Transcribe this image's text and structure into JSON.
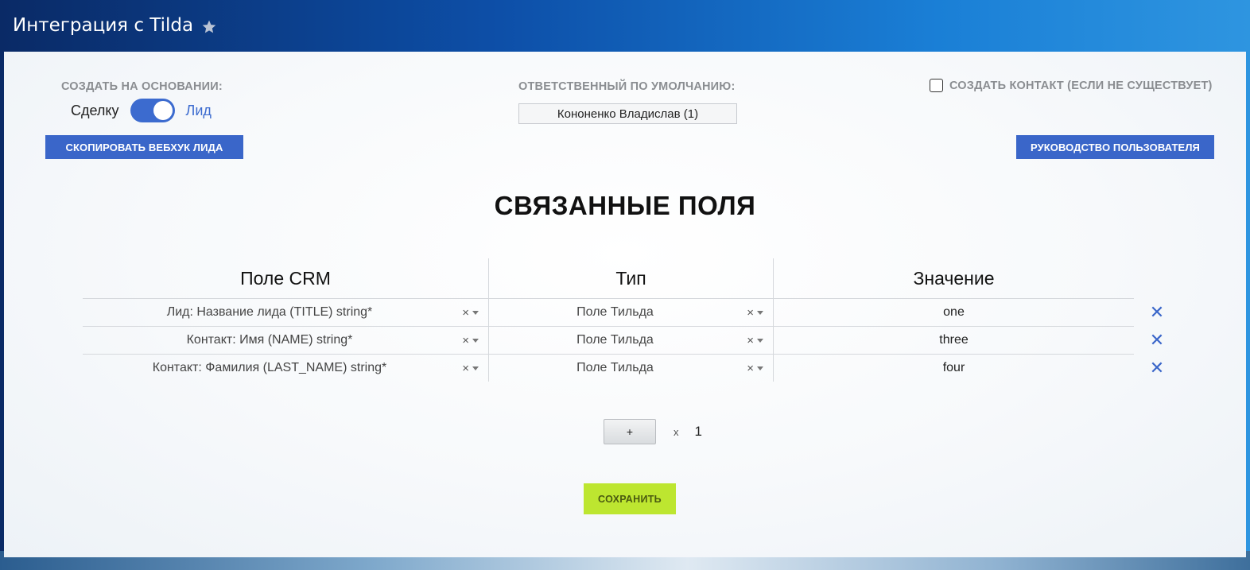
{
  "header": {
    "title": "Интеграция с Tilda",
    "star_icon": "star-icon"
  },
  "settings": {
    "basis_label": "СОЗДАТЬ НА ОСНОВАНИИ:",
    "toggle_left": "Сделку",
    "toggle_right": "Лид",
    "toggle_on": true,
    "responsible_label": "ОТВЕТСТВЕННЫЙ ПО УМОЛЧАНИЮ:",
    "responsible_value": "Кононенко Владислав (1)",
    "create_contact_label": "СОЗДАТЬ КОНТАКТ (ЕСЛИ НЕ СУЩЕСТВУЕТ)",
    "create_contact_checked": false,
    "copy_webhook_button": "СКОПИРОВАТЬ ВЕБХУК ЛИДА",
    "user_guide_button": "РУКОВОДСТВО ПОЛЬЗОВАТЕЛЯ"
  },
  "linked_fields": {
    "title": "СВЯЗАННЫЕ ПОЛЯ",
    "columns": [
      "Поле CRM",
      "Тип",
      "Значение"
    ],
    "rows": [
      {
        "crm_field": "Лид: Название лида (TITLE) string*",
        "type": "Поле Тильда",
        "value": "one"
      },
      {
        "crm_field": "Контакт: Имя (NAME) string*",
        "type": "Поле Тильда",
        "value": "three"
      },
      {
        "crm_field": "Контакт: Фамилия (LAST_NAME) string*",
        "type": "Поле Тильда",
        "value": "four"
      }
    ],
    "clear_glyph": "×",
    "delete_glyph": "✕"
  },
  "add_controls": {
    "add_label": "+",
    "multiplier": "x",
    "count": "1"
  },
  "save_button": "СОХРАНИТЬ",
  "colors": {
    "accent_blue": "#3a66c9",
    "save_green": "#bde630",
    "header_dark": "#0a2a66"
  }
}
